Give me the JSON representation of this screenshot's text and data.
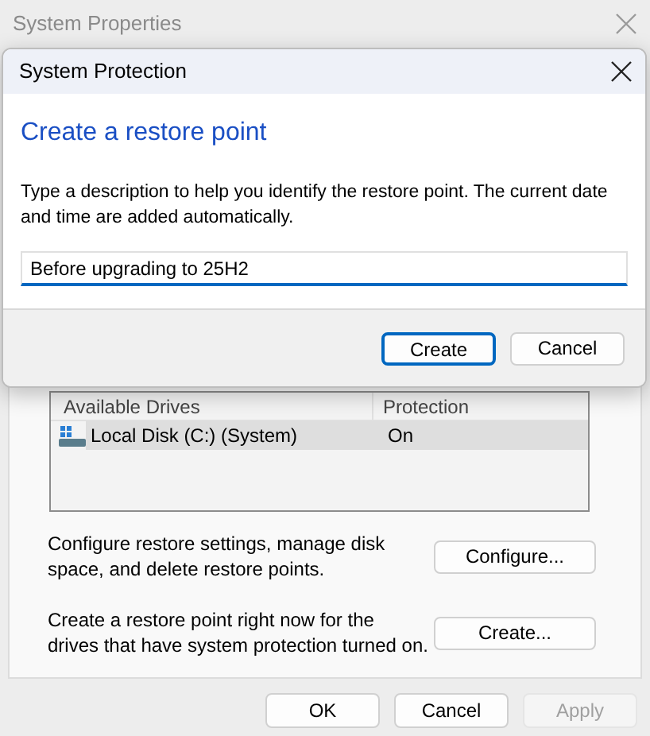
{
  "window": {
    "title": "System Properties"
  },
  "drives": {
    "columns": [
      "Available Drives",
      "Protection"
    ],
    "rows": [
      {
        "drive": "Local Disk (C:) (System)",
        "protection": "On",
        "selected": true
      }
    ]
  },
  "actions": [
    {
      "text": "Configure restore settings, manage disk space, and delete restore points.",
      "button": "Configure..."
    },
    {
      "text": "Create a restore point right now for the drives that have system protection turned on.",
      "button": "Create..."
    }
  ],
  "buttons": [
    {
      "label": "OK",
      "disabled": false
    },
    {
      "label": "Cancel",
      "disabled": false
    },
    {
      "label": "Apply",
      "disabled": true
    }
  ],
  "dialog": {
    "title": "System Protection",
    "heading": "Create a restore point",
    "description": "Type a description to help you identify the restore point. The current date and time are added automatically.",
    "field": {
      "value": "Before upgrading to 25H2"
    },
    "buttons": [
      {
        "label": "Create",
        "default": true
      },
      {
        "label": "Cancel",
        "default": false
      }
    ]
  }
}
